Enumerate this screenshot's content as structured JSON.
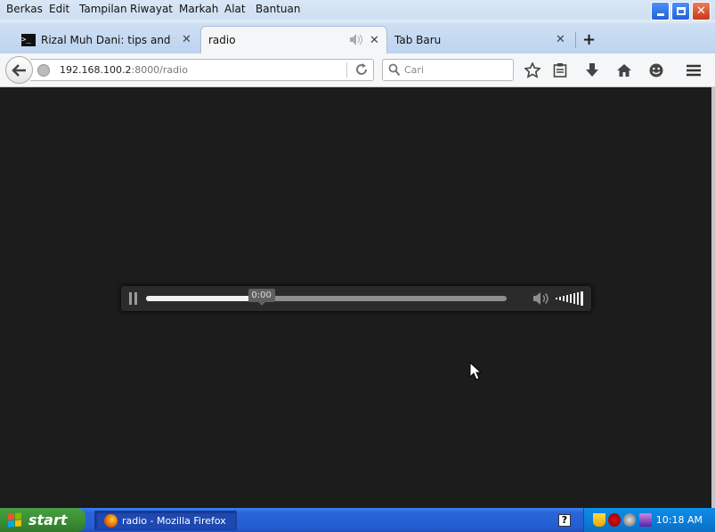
{
  "menu": {
    "berkas": "Berkas",
    "edit": "Edit",
    "tampilan": "Tampilan",
    "riwayat": "Riwayat",
    "markah": "Markah",
    "alat": "Alat",
    "bantuan": "Bantuan"
  },
  "tabs": [
    {
      "label": "Rizal Muh Dani: tips and trick",
      "active": false
    },
    {
      "label": "radio",
      "active": true
    },
    {
      "label": "Tab Baru",
      "active": false
    }
  ],
  "url": {
    "host": "192.168.100.2",
    "rest": ":8000/radio"
  },
  "search": {
    "placeholder": "Cari"
  },
  "player": {
    "time": "0:00",
    "progress": 0.32
  },
  "taskbar": {
    "start_label": "start",
    "task_label": "radio - Mozilla Firefox",
    "help": "?",
    "clock": "10:18 AM"
  },
  "colors": {
    "xp_blue": "#245dd4",
    "start_green": "#3b8f35",
    "content_bg": "#1c1c1c"
  }
}
